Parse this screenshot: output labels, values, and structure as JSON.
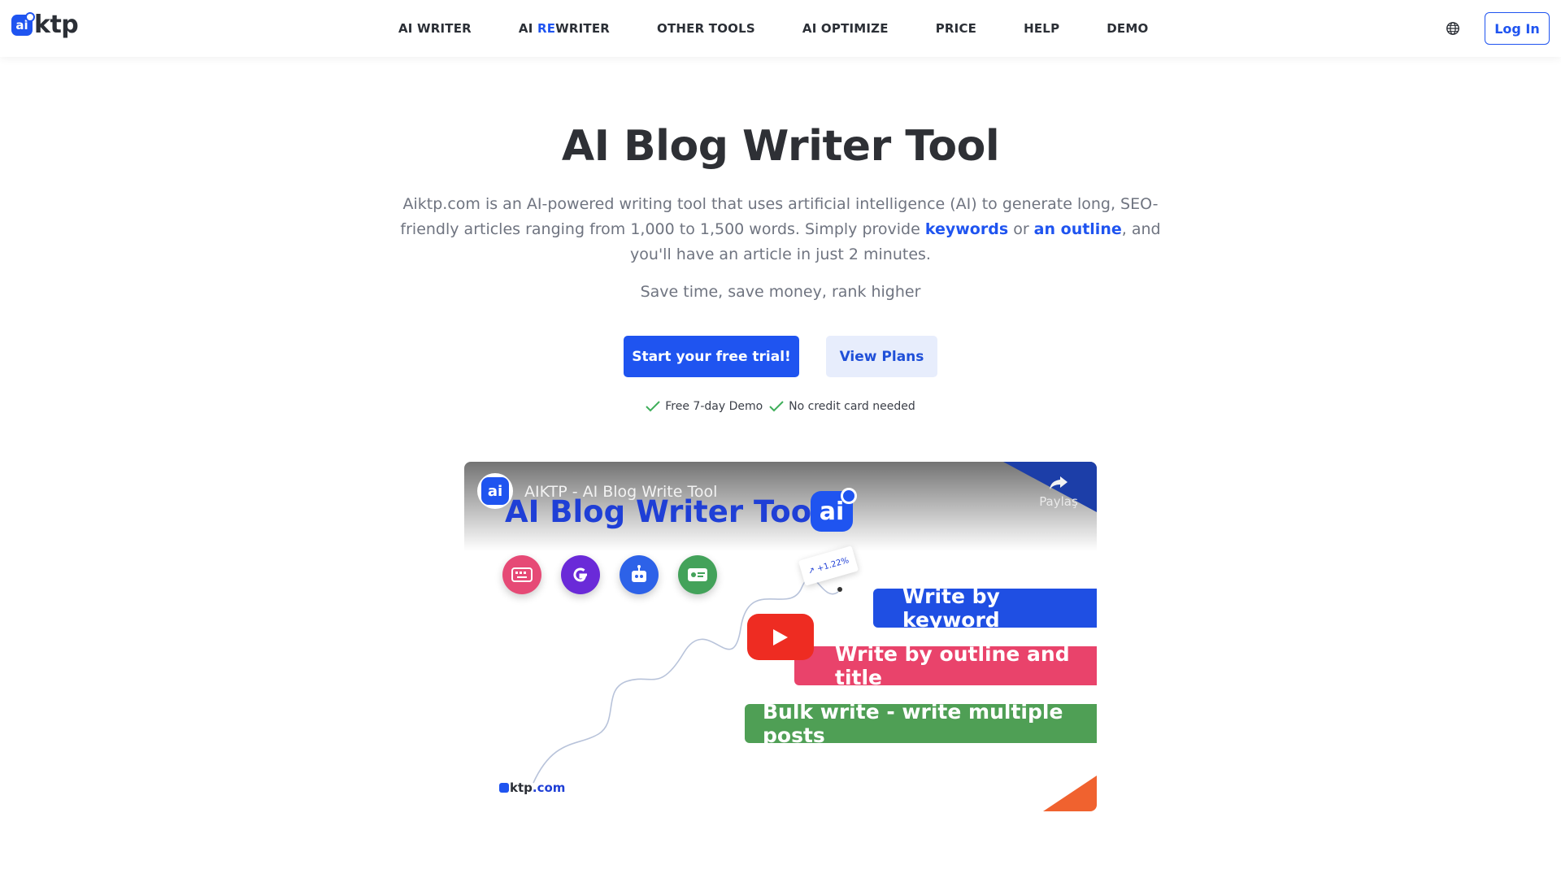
{
  "header": {
    "logo_text": "ktp",
    "logo_badge": "ai",
    "nav": [
      {
        "label": "AI WRITER"
      },
      {
        "label_prefix": "AI ",
        "label_accent": "RE",
        "label_suffix": "WRITER"
      },
      {
        "label": "OTHER TOOLS"
      },
      {
        "label": "AI OPTIMIZE"
      },
      {
        "label": "PRICE"
      },
      {
        "label": "HELP"
      },
      {
        "label": "DEMO"
      }
    ],
    "login_label": "Log In",
    "globe_icon": "globe-icon"
  },
  "hero": {
    "title": "AI Blog Writer Tool",
    "description_part1": "Aiktp.com is an AI-powered writing tool that uses artificial intelligence (AI) to generate long, SEO-friendly articles ranging from 1,000 to 1,500 words. Simply provide ",
    "link_keywords": "keywords",
    "description_or": " or ",
    "link_outline": "an outline",
    "description_part2": ", and you'll have an article in just 2 minutes.",
    "tagline": "Save time, save money, rank higher",
    "primary_button": "Start your free trial!",
    "secondary_button": "View Plans",
    "checks": [
      "Free 7-day Demo",
      "No credit card needed"
    ]
  },
  "video": {
    "channel_badge": "ai",
    "title": "AIKTP - AI Blog Write Tool",
    "share_label": "Paylaş",
    "heading": "AI Blog Writer Tool",
    "big_badge": "ai",
    "stat": "↗ +1.22%",
    "bands": [
      "Write by keyword",
      "Write by outline and title",
      "Bulk write - write multiple posts"
    ],
    "site_prefix": "ai",
    "site_dark": "ktp",
    "site_suffix": ".com",
    "colors": {
      "blue": "#1f4fe3",
      "pink": "#e9436b",
      "green": "#4f9f55",
      "red": "#ee2c22",
      "orange": "#f0622f"
    }
  },
  "colors": {
    "accent": "#1f54f0",
    "text": "#2b2f36",
    "muted": "#6f7480"
  }
}
